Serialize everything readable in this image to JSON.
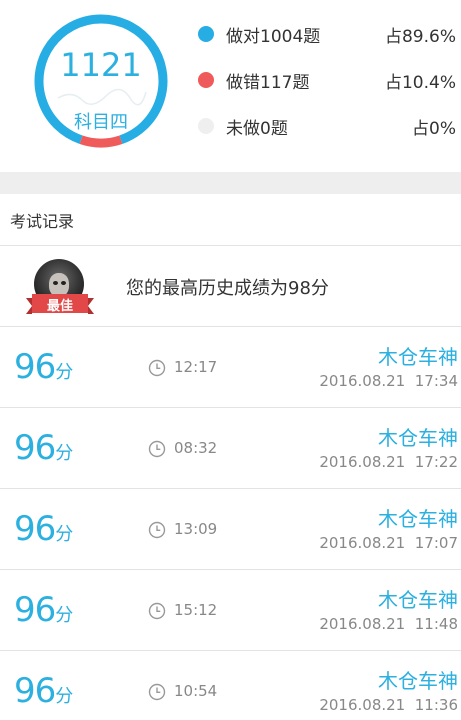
{
  "summary": {
    "total": "1121",
    "subject": "科目四",
    "correct_ratio": 0.896,
    "wrong_ratio": 0.104,
    "colors": {
      "correct": "#26ade4",
      "wrong": "#ef5b5b",
      "undone": "#efefef"
    },
    "legend": [
      {
        "label": "做对1004题",
        "percent": "占89.6%",
        "color": "#26ade4"
      },
      {
        "label": "做错117题",
        "percent": "占10.4%",
        "color": "#ef5b5b"
      },
      {
        "label": "未做0题",
        "percent": "占0%",
        "color": "#efefef"
      }
    ]
  },
  "records_section": {
    "title": "考试记录",
    "best": {
      "badge": "最佳",
      "text": "您的最高历史成绩为98分"
    },
    "items": [
      {
        "score": "96",
        "unit": "分",
        "duration": "12:17",
        "title": "木仓车神",
        "date": "2016.08.21",
        "time": "17:34"
      },
      {
        "score": "96",
        "unit": "分",
        "duration": "08:32",
        "title": "木仓车神",
        "date": "2016.08.21",
        "time": "17:22"
      },
      {
        "score": "96",
        "unit": "分",
        "duration": "13:09",
        "title": "木仓车神",
        "date": "2016.08.21",
        "time": "17:07"
      },
      {
        "score": "96",
        "unit": "分",
        "duration": "15:12",
        "title": "木仓车神",
        "date": "2016.08.21",
        "time": "11:48"
      },
      {
        "score": "96",
        "unit": "分",
        "duration": "10:54",
        "title": "木仓车神",
        "date": "2016.08.21",
        "time": "11:36"
      }
    ],
    "icons": {
      "duration": "clock-icon",
      "avatar": "avatar-image",
      "badge": "ribbon-badge"
    }
  }
}
